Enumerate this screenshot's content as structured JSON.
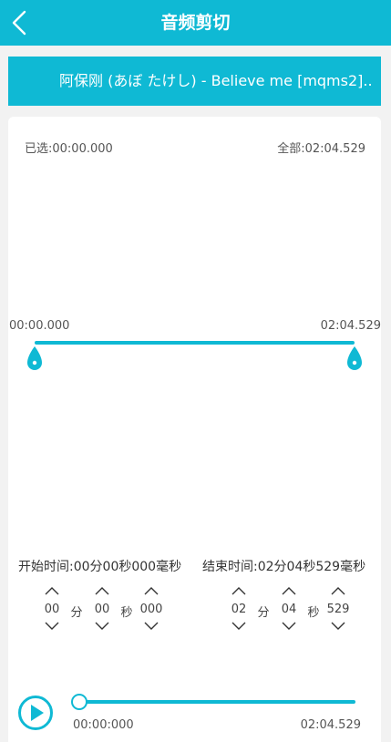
{
  "header": {
    "title": "音频剪切"
  },
  "file": {
    "name": "阿保刚 (あぼ たけし) - Believe me [mqms2]...."
  },
  "selection": {
    "selected": "已选:00:00.000",
    "total": "全部:02:04.529"
  },
  "range": {
    "start_label": "00:00.000",
    "end_label": "02:04.529",
    "start_fraction": 0.0,
    "end_fraction": 1.0
  },
  "start_time": {
    "label": "开始时间:00分00秒000毫秒",
    "minutes": "00",
    "seconds": "00",
    "millis": "000",
    "min_unit": "分",
    "sec_unit": "秒"
  },
  "end_time": {
    "label": "结束时间:02分04秒529毫秒",
    "minutes": "02",
    "seconds": "04",
    "millis": "529",
    "min_unit": "分",
    "sec_unit": "秒"
  },
  "player": {
    "current": "00:00:000",
    "duration": "02:04.529",
    "progress": 0.0
  },
  "colors": {
    "accent": "#0fb9d4",
    "background": "#f2f2f2",
    "card": "#ffffff"
  },
  "icons": {
    "back": "back-chevron-icon",
    "play": "play-circle-icon",
    "handle": "drop-handle-icon",
    "up": "chevron-up-icon",
    "down": "chevron-down-icon"
  }
}
